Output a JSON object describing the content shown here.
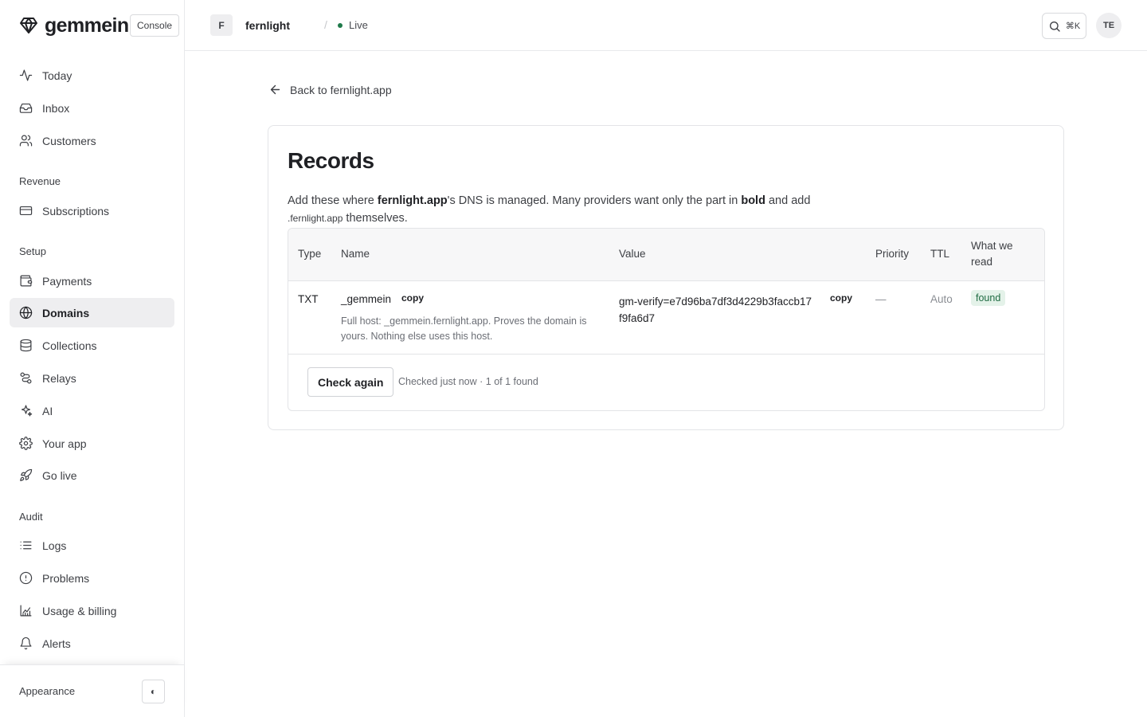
{
  "brand": {
    "name": "gemmein",
    "console_label": "Console"
  },
  "sidebar": {
    "items_top": [
      {
        "label": "Today",
        "icon": "activity-icon"
      },
      {
        "label": "Inbox",
        "icon": "inbox-icon"
      },
      {
        "label": "Customers",
        "icon": "users-icon"
      }
    ],
    "sections": [
      {
        "label": "Revenue",
        "items": [
          {
            "label": "Subscriptions",
            "icon": "credit-card-icon"
          }
        ]
      },
      {
        "label": "Setup",
        "items": [
          {
            "label": "Payments",
            "icon": "wallet-icon"
          },
          {
            "label": "Domains",
            "icon": "globe-icon",
            "active": true
          },
          {
            "label": "Collections",
            "icon": "database-icon"
          },
          {
            "label": "Relays",
            "icon": "route-icon"
          },
          {
            "label": "AI",
            "icon": "sparkles-icon"
          },
          {
            "label": "Your app",
            "icon": "gear-icon"
          },
          {
            "label": "Go live",
            "icon": "rocket-icon"
          }
        ]
      },
      {
        "label": "Audit",
        "items": [
          {
            "label": "Logs",
            "icon": "list-icon"
          },
          {
            "label": "Problems",
            "icon": "alert-circle-icon"
          },
          {
            "label": "Usage & billing",
            "icon": "chart-icon"
          },
          {
            "label": "Alerts",
            "icon": "bell-icon"
          }
        ]
      }
    ],
    "footer": {
      "appearance_label": "Appearance",
      "theme_toggle": "◐"
    }
  },
  "topbar": {
    "project_initial": "F",
    "project_name": "fernlight",
    "separator": "/",
    "status": "Live",
    "search_shortcut": "⌘K",
    "avatar_initials": "TE"
  },
  "main": {
    "back_label": "Back to fernlight.app",
    "title": "Records",
    "desc": {
      "p1": "Add these where ",
      "domain": "fernlight.app",
      "p2": "'s DNS is managed. Many providers want only the part in ",
      "bold_word": "bold",
      "p3": " and add",
      "suffix": ".fernlight.app",
      "p4": " themselves."
    },
    "table": {
      "headers": {
        "type": "Type",
        "name": "Name",
        "value": "Value",
        "priority": "Priority",
        "ttl": "TTL",
        "read_l1": "What we",
        "read_l2": "read"
      },
      "row": {
        "type": "TXT",
        "name": "_gemmein",
        "name_copy": "copy",
        "hint_l1": "Full host: _gemmein.fernlight.app. Proves the domain is",
        "hint_l2": "yours. Nothing else uses this host.",
        "value_l1": "gm-verify=e7d96ba7df3d4229b3faccb17",
        "value_l2": "f9fa6d7",
        "value_copy": "copy",
        "priority": "—",
        "ttl": "Auto",
        "read": "found"
      }
    },
    "check_again": "Check again",
    "status_text": "Checked just now · 1 of 1 found"
  },
  "colors": {
    "found_bg": "#e4f2e9",
    "found_text": "#1f6b42",
    "live_dot": "#1f7a4a",
    "active_nav_bg": "#eeeef0"
  }
}
